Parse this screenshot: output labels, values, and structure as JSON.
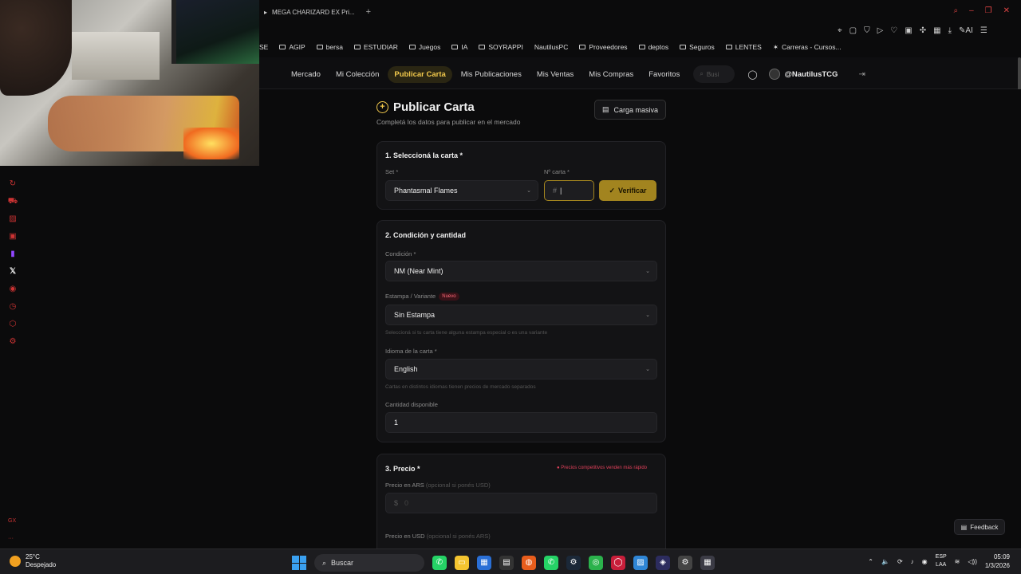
{
  "browser": {
    "tab_title": "MEGA CHARIZARD EX Pri...",
    "bookmarks": [
      "SE",
      "AGIP",
      "bersa",
      "ESTUDIAR",
      "Juegos",
      "IA",
      "SOYRAPPI",
      "NautilusPC",
      "Proveedores",
      "deptos",
      "Seguros",
      "LENTES",
      "Carreras - Cursos..."
    ]
  },
  "nav": {
    "items": [
      "Mercado",
      "Mi Colección",
      "Publicar Carta",
      "Mis Publicaciones",
      "Mis Ventas",
      "Mis Compras",
      "Favoritos"
    ],
    "active": "Publicar Carta",
    "search_placeholder": "Busi",
    "username": "@NautilusTCG"
  },
  "page": {
    "title": "Publicar Carta",
    "subtitle": "Completá los datos para publicar en el mercado",
    "bulk_button": "Carga masiva"
  },
  "section1": {
    "title": "1. Seleccioná la carta *",
    "set_label": "Set *",
    "set_value": "Phantasmal Flames",
    "number_label": "Nº carta *",
    "number_placeholder": "#",
    "verify_button": "Verificar"
  },
  "section2": {
    "title": "2. Condición y cantidad",
    "condition_label": "Condición *",
    "condition_value": "NM (Near Mint)",
    "stamp_label": "Estampa / Variante",
    "stamp_badge": "Nuevo",
    "stamp_value": "Sin Estampa",
    "stamp_help": "Seleccioná si tu carta tiene alguna estampa especial o es una variante",
    "language_label": "Idioma de la carta *",
    "language_value": "English",
    "language_help": "Cartas en distintos idiomas tienen precios de mercado separados",
    "quantity_label": "Cantidad disponible",
    "quantity_value": "1"
  },
  "section3": {
    "title": "3. Precio *",
    "hint": "● Precios competitivos venden más rápido",
    "ars_label": "Precio en ARS",
    "ars_optional": "(opcional si ponés USD)",
    "ars_prefix": "$",
    "ars_placeholder": "0",
    "usd_label": "Precio en USD",
    "usd_optional": "(opcional si ponés ARS)"
  },
  "feedback": "Feedback",
  "taskbar": {
    "temperature": "25°C",
    "weather": "Despejado",
    "search": "Buscar",
    "lang_top": "ESP",
    "lang_bottom": "LAA",
    "time": "05:09",
    "date": "1/3/2026"
  }
}
